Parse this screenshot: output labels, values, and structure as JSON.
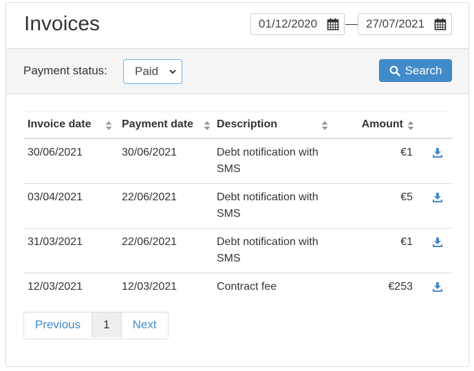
{
  "header": {
    "title": "Invoices",
    "date_from": "01/12/2020",
    "date_to": "27/07/2021"
  },
  "filter": {
    "label": "Payment status:",
    "status_value": "Paid",
    "search_label": "Search"
  },
  "table": {
    "columns": [
      "Invoice date",
      "Payment date",
      "Description",
      "Amount"
    ],
    "rows": [
      {
        "invoice_date": "30/06/2021",
        "payment_date": "30/06/2021",
        "description": "Debt notification with SMS",
        "amount": "€1"
      },
      {
        "invoice_date": "03/04/2021",
        "payment_date": "22/06/2021",
        "description": "Debt notification with SMS",
        "amount": "€5"
      },
      {
        "invoice_date": "31/03/2021",
        "payment_date": "22/06/2021",
        "description": "Debt notification with SMS",
        "amount": "€1"
      },
      {
        "invoice_date": "12/03/2021",
        "payment_date": "12/03/2021",
        "description": "Contract fee",
        "amount": "€253"
      }
    ]
  },
  "pagination": {
    "previous": "Previous",
    "current": "1",
    "next": "Next"
  },
  "colors": {
    "accent": "#428bca",
    "filter_bg": "#f5f5f5"
  },
  "icons": {
    "calendar": "calendar-icon",
    "search": "search-icon",
    "sort": "sort-icon",
    "download": "download-icon",
    "select_chevron": "chevron-down-icon"
  }
}
